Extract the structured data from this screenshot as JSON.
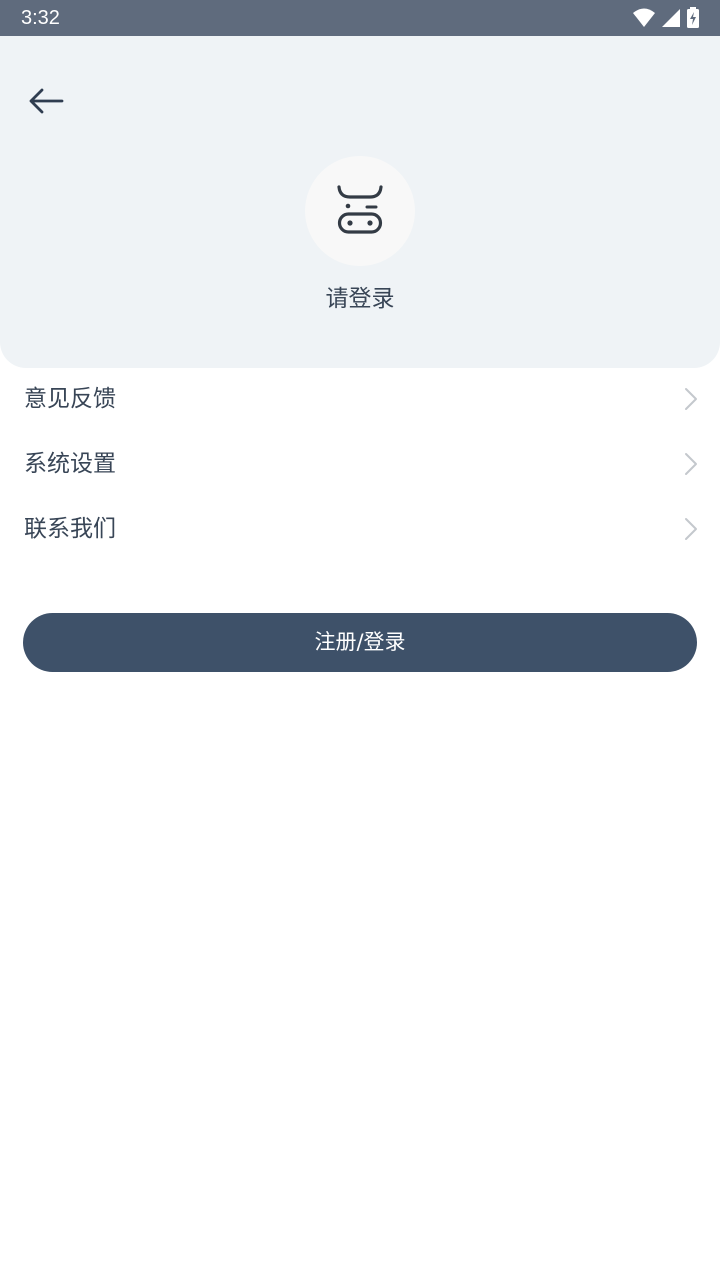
{
  "status_bar": {
    "time": "3:32",
    "icons": [
      "wifi-icon",
      "signal-icon",
      "battery-charging-icon"
    ]
  },
  "header": {
    "back_icon": "arrow-left-icon",
    "avatar_icon": "cow-face-icon",
    "login_prompt": "请登录",
    "background_color": "#eff3f6"
  },
  "menu": {
    "items": [
      {
        "label": "意见反馈",
        "icon": "chevron-right-icon"
      },
      {
        "label": "系统设置",
        "icon": "chevron-right-icon"
      },
      {
        "label": "联系我们",
        "icon": "chevron-right-icon"
      }
    ]
  },
  "actions": {
    "register_login_label": "注册/登录",
    "button_color": "#3e5169"
  }
}
